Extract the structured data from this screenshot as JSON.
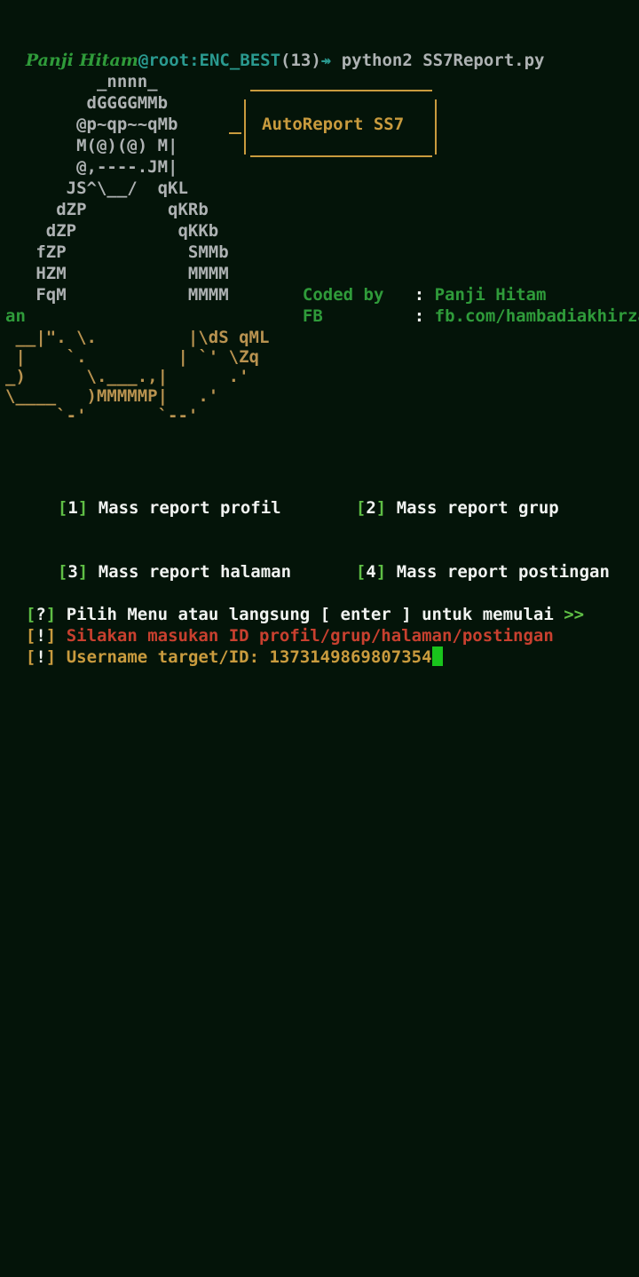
{
  "prompt": {
    "user": "Panji Hitam",
    "host": "@root:ENC_BEST",
    "count": "(13)",
    "arrow": "↠",
    "command": "python2 SS7Report.py"
  },
  "banner": {
    "art_top": [
      "         _nnnn_",
      "        dGGGGMMb",
      "       @p~qp~~qMb",
      "       M(@)(@) M|",
      "       @,----.JM|",
      "      JS^\\__/  qKL",
      "     dZP        qKRb",
      "    dZP          qKKb",
      "   fZP            SMMb",
      "   HZM            MMMM",
      "   FqM            MMMM"
    ],
    "art_bottom": [
      " __|\". \\.         |\\dS qML",
      " |    `.         | `' \\Zq",
      "_)      \\.___.,|      .'",
      "\\____   )MMMMMP|   .'",
      "     `-'       `--'"
    ],
    "box_title": "AutoReport SS7",
    "coded_by_label": "Coded by",
    "coded_by_value": "Panji Hitam",
    "fb_label": "FB",
    "fb_value": "fb.com/hambadiakhirzam",
    "fb_wrap": "an"
  },
  "menu": [
    {
      "key": "1",
      "label": "Mass report profil"
    },
    {
      "key": "2",
      "label": "Mass report grup"
    },
    {
      "key": "3",
      "label": "Mass report halaman"
    },
    {
      "key": "4",
      "label": "Mass report postingan"
    }
  ],
  "messages": {
    "question_tag": "?",
    "question": "Pilih Menu atau langsung [ enter ] untuk memulai",
    "question_arrow": ">>",
    "warn_tag": "!",
    "warn": "Silakan masukan ID profil/grup/halaman/postingan",
    "input_tag": "!",
    "input_label": "Username target/ID: ",
    "input_value": "1373149869807354"
  },
  "colors": {
    "background": "#041409",
    "cursor": "#19c41c",
    "accent_green": "#2f9b3a",
    "warning_red": "#c8402f",
    "gold": "#c99b3e"
  }
}
